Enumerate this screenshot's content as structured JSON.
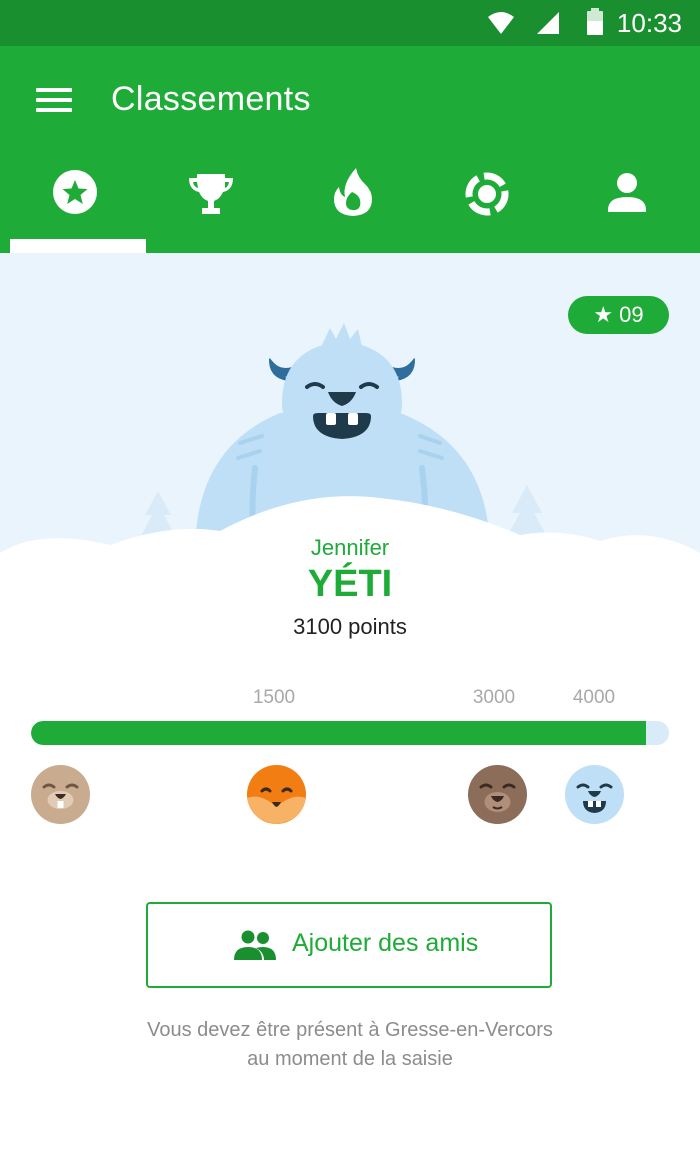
{
  "status_bar": {
    "time": "10:33",
    "icons": [
      "wifi-icon",
      "signal-icon",
      "battery-icon"
    ]
  },
  "app_bar": {
    "title": "Classements",
    "menu_icon": "hamburger-menu-icon"
  },
  "tabs": [
    {
      "id": "tab-stars",
      "icon": "star-circle-icon",
      "selected": true
    },
    {
      "id": "tab-trophy",
      "icon": "trophy-icon",
      "selected": false
    },
    {
      "id": "tab-flame",
      "icon": "flame-icon",
      "selected": false
    },
    {
      "id": "tab-target",
      "icon": "target-ring-icon",
      "selected": false
    },
    {
      "id": "tab-profile",
      "icon": "person-icon",
      "selected": false
    }
  ],
  "badge": {
    "text": "★ 09"
  },
  "profile": {
    "name": "Jennifer",
    "rank": "YÉTI",
    "points_text": "3100 points",
    "points": 3100
  },
  "progress": {
    "min": 0,
    "max": 4150,
    "value": 4000,
    "ticks": [
      {
        "label": "1500",
        "value": 1500
      },
      {
        "label": "3000",
        "value": 3000
      },
      {
        "label": "4000",
        "value": 4000
      }
    ],
    "levels": [
      "beaver-icon",
      "fox-icon",
      "bear-icon",
      "yeti-icon"
    ]
  },
  "add_friends": {
    "label": "Ajouter des amis",
    "icon": "people-icon"
  },
  "note": {
    "line1": "Vous devez être présent à Gresse-en-Vercors",
    "line2": "au moment de la saisie"
  },
  "colors": {
    "primary": "#1fab38",
    "status_bar": "#1a8f30",
    "hero_bg": "#eaf4fc",
    "progress_track": "#d7ebf9"
  }
}
